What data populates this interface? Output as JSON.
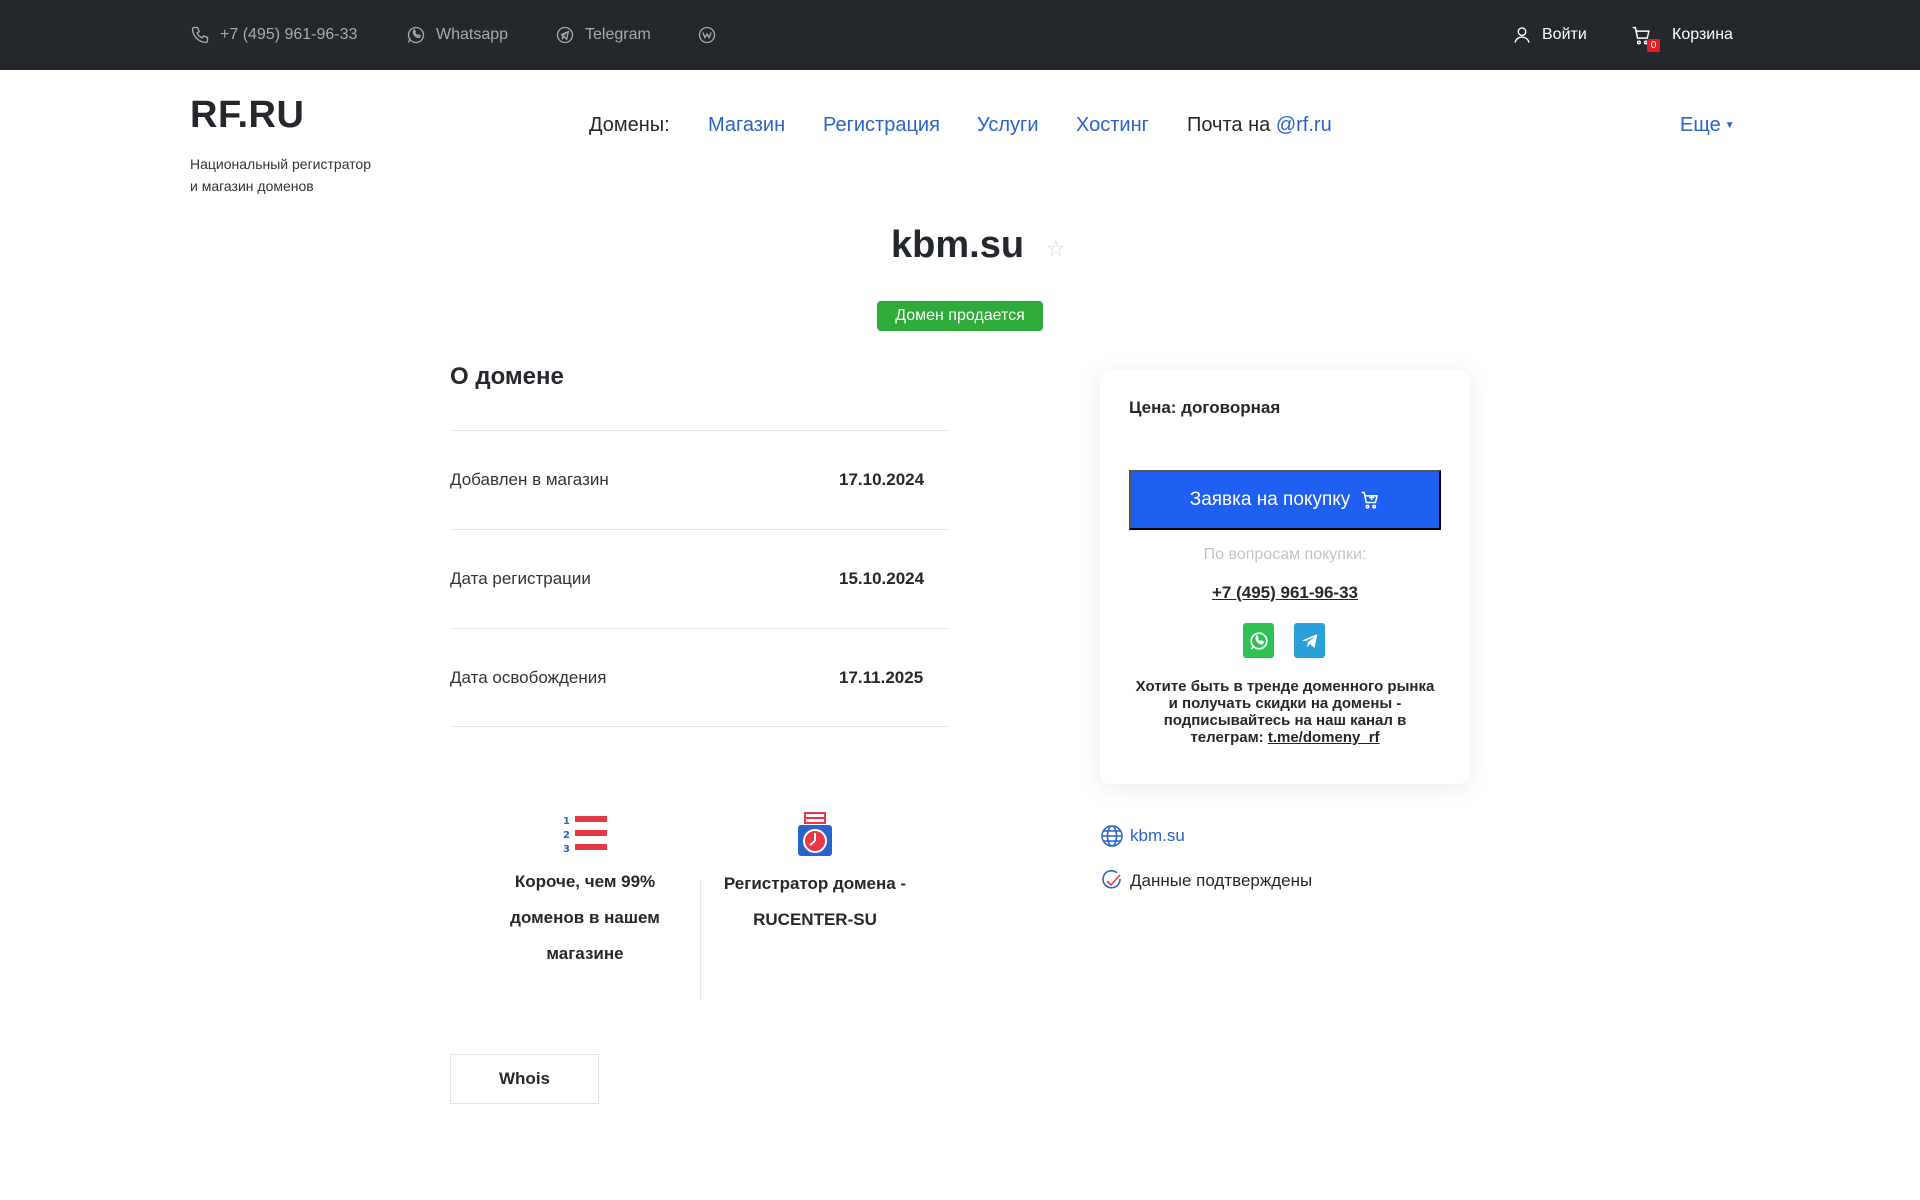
{
  "topbar": {
    "phone": "+7 (495) 961-96-33",
    "whatsapp": "Whatsapp",
    "telegram": "Telegram",
    "login": "Войти",
    "cart": "Корзина",
    "cart_count": "0"
  },
  "header": {
    "logo": "RF.RU",
    "tagline_line1": "Национальный регистратор",
    "tagline_line2": "и магазин доменов",
    "nav_label": "Домены:",
    "nav": [
      "Магазин",
      "Регистрация",
      "Услуги",
      "Хостинг"
    ],
    "mail_prefix": "Почта на",
    "mail_domain": "@rf.ru",
    "more": "Еще"
  },
  "domain": {
    "name": "kbm.su",
    "status": "Домен продается"
  },
  "about": {
    "title": "О домене",
    "rows": [
      {
        "label": "Добавлен в магазин",
        "value": "17.10.2024"
      },
      {
        "label": "Дата регистрации",
        "value": "15.10.2024"
      },
      {
        "label": "Дата освобождения",
        "value": "17.11.2025"
      }
    ]
  },
  "features": [
    {
      "line1": "Короче, чем 99%",
      "line2": "доменов в нашем",
      "line3": "магазине"
    },
    {
      "line1": "Регистратор домена -",
      "line2": "RUCENTER-SU"
    }
  ],
  "whois": "Whois",
  "card": {
    "price": "Цена: договорная",
    "buy": "Заявка на покупку",
    "questions": "По вопросам покупки:",
    "phone": "+7 (495) 961-96-33",
    "promo_text": "Хотите быть в тренде доменного рынка и получать скидки на домены - подписывайтесь на наш канал в телеграм:",
    "promo_link": "t.me/domeny_rf"
  },
  "side": {
    "domain_link": "kbm.su",
    "verified": "Данные подтверждены"
  },
  "colors": {
    "topbar": "#24282c",
    "link": "#2a63c9",
    "buy": "#1f5ff2",
    "sale": "#2eab38",
    "whatsapp": "#2ec254",
    "telegram": "#2aa0d8",
    "accent_red": "#e63946"
  }
}
